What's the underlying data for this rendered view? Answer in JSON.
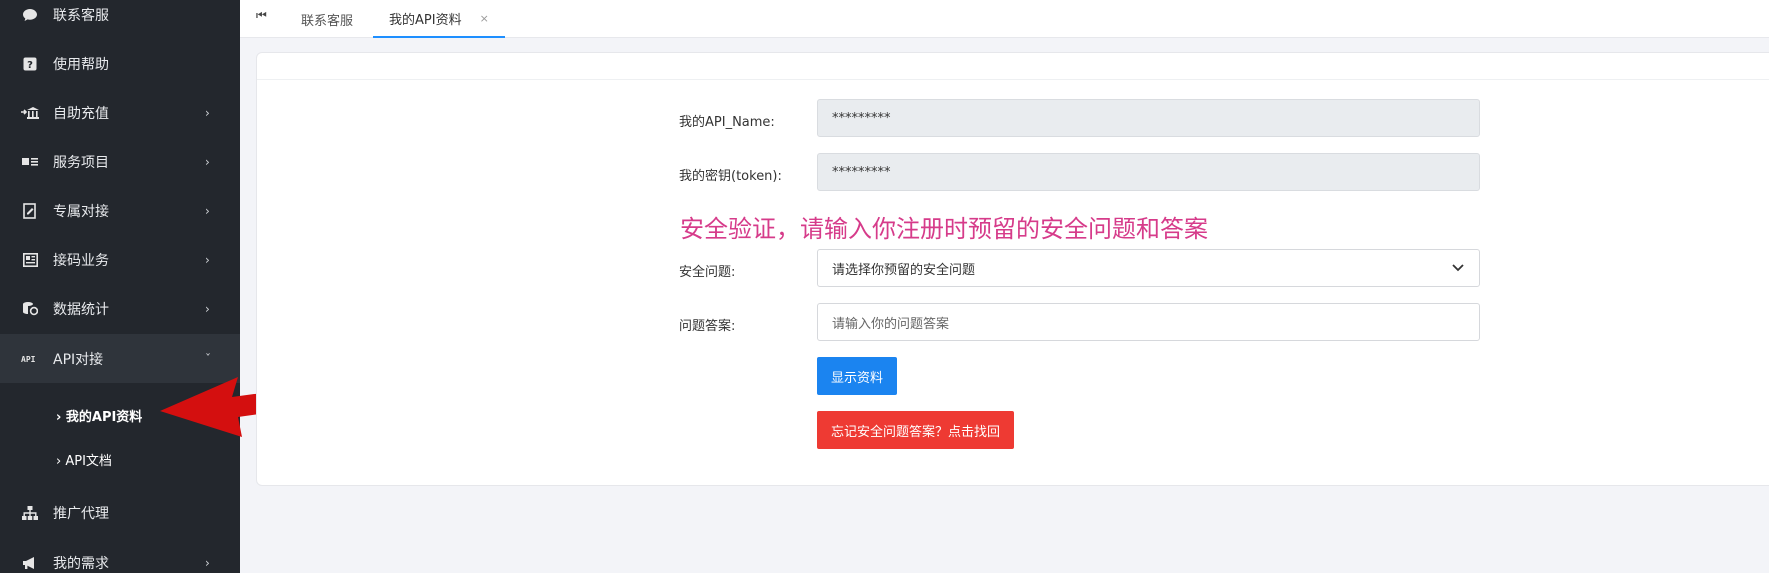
{
  "sidebar": {
    "items": [
      {
        "label": "联系客服",
        "icon": "chat-bubble-icon",
        "has_chevron": false
      },
      {
        "label": "使用帮助",
        "icon": "question-square-icon",
        "has_chevron": false
      },
      {
        "label": "自助充值",
        "icon": "bank-icon",
        "has_chevron": true
      },
      {
        "label": "服务项目",
        "icon": "id-card-icon",
        "has_chevron": true
      },
      {
        "label": "专属对接",
        "icon": "document-edit-icon",
        "has_chevron": true
      },
      {
        "label": "接码业务",
        "icon": "grid-box-icon",
        "has_chevron": true
      },
      {
        "label": "数据统计",
        "icon": "database-icon",
        "has_chevron": true
      },
      {
        "label": "API对接",
        "icon": "api-icon",
        "has_chevron": true,
        "expanded": true
      },
      {
        "label": "推广代理",
        "icon": "sitemap-icon",
        "has_chevron": false
      },
      {
        "label": "我的需求",
        "icon": "megaphone-icon",
        "has_chevron": true
      }
    ],
    "api_subitems": [
      {
        "label": "› 我的API资料",
        "active": true
      },
      {
        "label": "› API文档",
        "active": false
      }
    ]
  },
  "tabs": {
    "items": [
      {
        "label": "联系客服",
        "active": false
      },
      {
        "label": "我的API资料",
        "active": true,
        "close": "×"
      }
    ]
  },
  "form": {
    "api_name_label": "我的API_Name:",
    "api_name_value": "*********",
    "token_label": "我的密钥(token):",
    "token_value": "*********",
    "notice": "安全验证，请输入你注册时预留的安全问题和答案",
    "question_label": "安全问题:",
    "question_select": "请选择你预留的安全问题",
    "answer_label": "问题答案:",
    "answer_placeholder": "请输入你的问题答案",
    "show_button": "显示资料",
    "forgot_button": "忘记安全问题答案？点击找回"
  },
  "colors": {
    "sidebar_bg": "#23272d",
    "primary": "#1b84f0",
    "danger": "#ee3a33",
    "notice": "#d63b8a",
    "arrow": "#d40f0f"
  }
}
